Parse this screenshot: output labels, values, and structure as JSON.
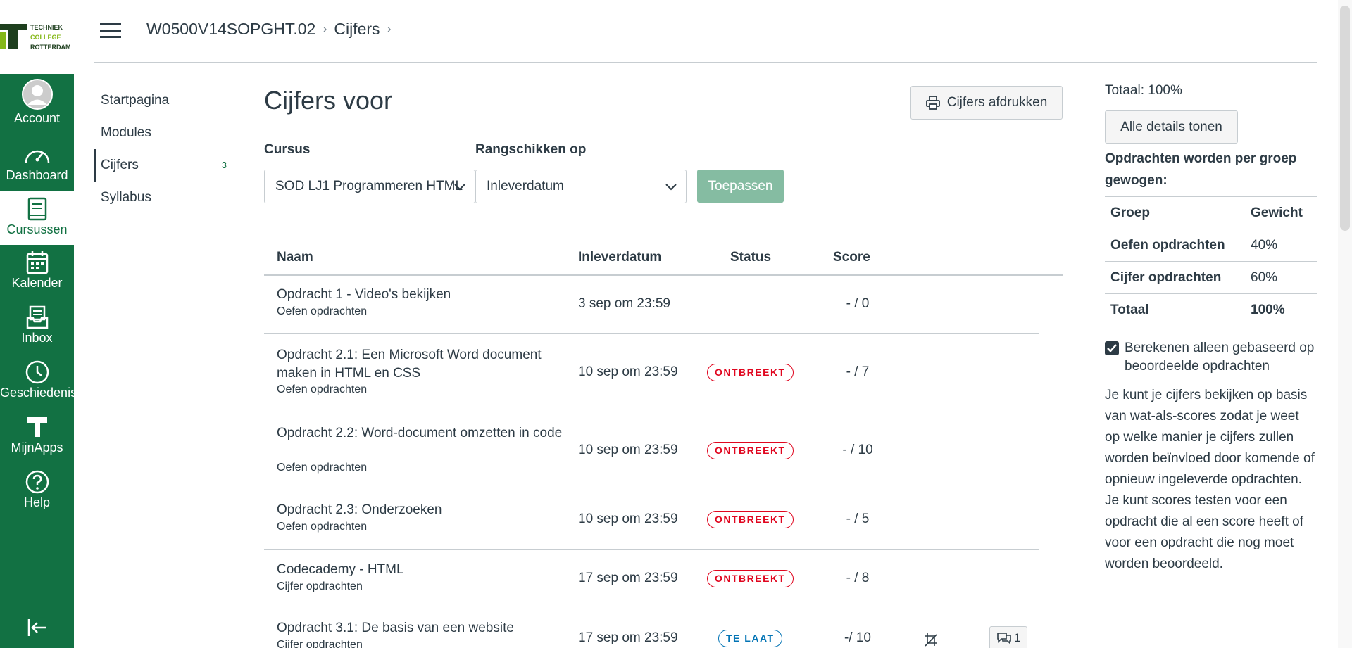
{
  "logo": {
    "line1": "TECHNIEK",
    "line2": "COLLEGE",
    "line3": "ROTTERDAM"
  },
  "global_nav": [
    {
      "label": "Account",
      "icon": "avatar-icon"
    },
    {
      "label": "Dashboard",
      "icon": "dashboard-icon"
    },
    {
      "label": "Cursussen",
      "icon": "courses-icon",
      "active": true
    },
    {
      "label": "Kalender",
      "icon": "calendar-icon"
    },
    {
      "label": "Inbox",
      "icon": "inbox-icon"
    },
    {
      "label": "Geschiedenis",
      "icon": "history-icon"
    },
    {
      "label": "MijnApps",
      "icon": "apps-icon"
    },
    {
      "label": "Help",
      "icon": "help-icon"
    }
  ],
  "breadcrumb": {
    "course": "W0500V14SOPGHT.02",
    "page": "Cijfers",
    "sep": "›"
  },
  "course_nav": {
    "items": [
      "Startpagina",
      "Modules",
      "Cijfers",
      "Syllabus"
    ],
    "badge": "3"
  },
  "main": {
    "title": "Cijfers voor",
    "print_label": "Cijfers afdrukken",
    "course_label": "Cursus",
    "course_value": "SOD LJ1 Programmeren HTML",
    "sort_label": "Rangschikken op",
    "sort_value": "Inleverdatum",
    "apply_label": "Toepassen"
  },
  "table": {
    "headers": {
      "name": "Naam",
      "date": "Inleverdatum",
      "status": "Status",
      "score": "Score"
    },
    "rows": [
      {
        "name": "Opdracht 1 - Video's bekijken",
        "group": "Oefen opdrachten",
        "date": "3 sep om 23:59",
        "status": "",
        "score": "- / 0"
      },
      {
        "name": "Opdracht 2.1: Een Microsoft Word document maken in HTML en CSS",
        "group": "Oefen opdrachten",
        "date": "10 sep om 23:59",
        "status": "ONTBREEKT",
        "score": "- / 7"
      },
      {
        "name": "Opdracht 2.2: Word-document omzetten in code",
        "group": "Oefen opdrachten",
        "date": "10 sep om 23:59",
        "status": "ONTBREEKT",
        "score": "- / 10"
      },
      {
        "name": "Opdracht 2.3: Onderzoeken",
        "group": "Oefen opdrachten",
        "date": "10 sep om 23:59",
        "status": "ONTBREEKT",
        "score": "- / 5"
      },
      {
        "name": "Codecademy - HTML",
        "group": "Cijfer opdrachten",
        "date": "17 sep om 23:59",
        "status": "ONTBREEKT",
        "score": "- / 8"
      },
      {
        "name": "Opdracht 3.1: De basis van een website",
        "group": "Cijfer opdrachten",
        "date": "17 sep om 23:59",
        "status": "TE LAAT",
        "score": "-/ 10",
        "comments": "1"
      }
    ]
  },
  "sidebar": {
    "total": "Totaal: 100%",
    "details_label": "Alle details tonen",
    "weights_title": "Opdrachten worden per groep gewogen:",
    "weights_header": {
      "group": "Groep",
      "weight": "Gewicht"
    },
    "weights": [
      {
        "group": "Oefen opdrachten",
        "weight": "40%"
      },
      {
        "group": "Cijfer opdrachten",
        "weight": "60%"
      }
    ],
    "weights_total": {
      "group": "Totaal",
      "weight": "100%"
    },
    "checkbox_label": "Berekenen alleen gebaseerd op beoordeelde opdrachten",
    "checkbox_checked": true,
    "info": "Je kunt je cijfers bekijken op basis van wat-als-scores zodat je weet op welke manier je cijfers zullen worden beïnvloed door komende of opnieuw ingeleverde opdrachten. Je kunt scores testen voor een opdracht die al een score heeft of voor een opdracht die nog moet worden beoordeeld."
  },
  "colors": {
    "nav_bg": "#127143",
    "missing": "#e0061f",
    "late": "#0374b5",
    "apply_bg": "#85bca2"
  }
}
